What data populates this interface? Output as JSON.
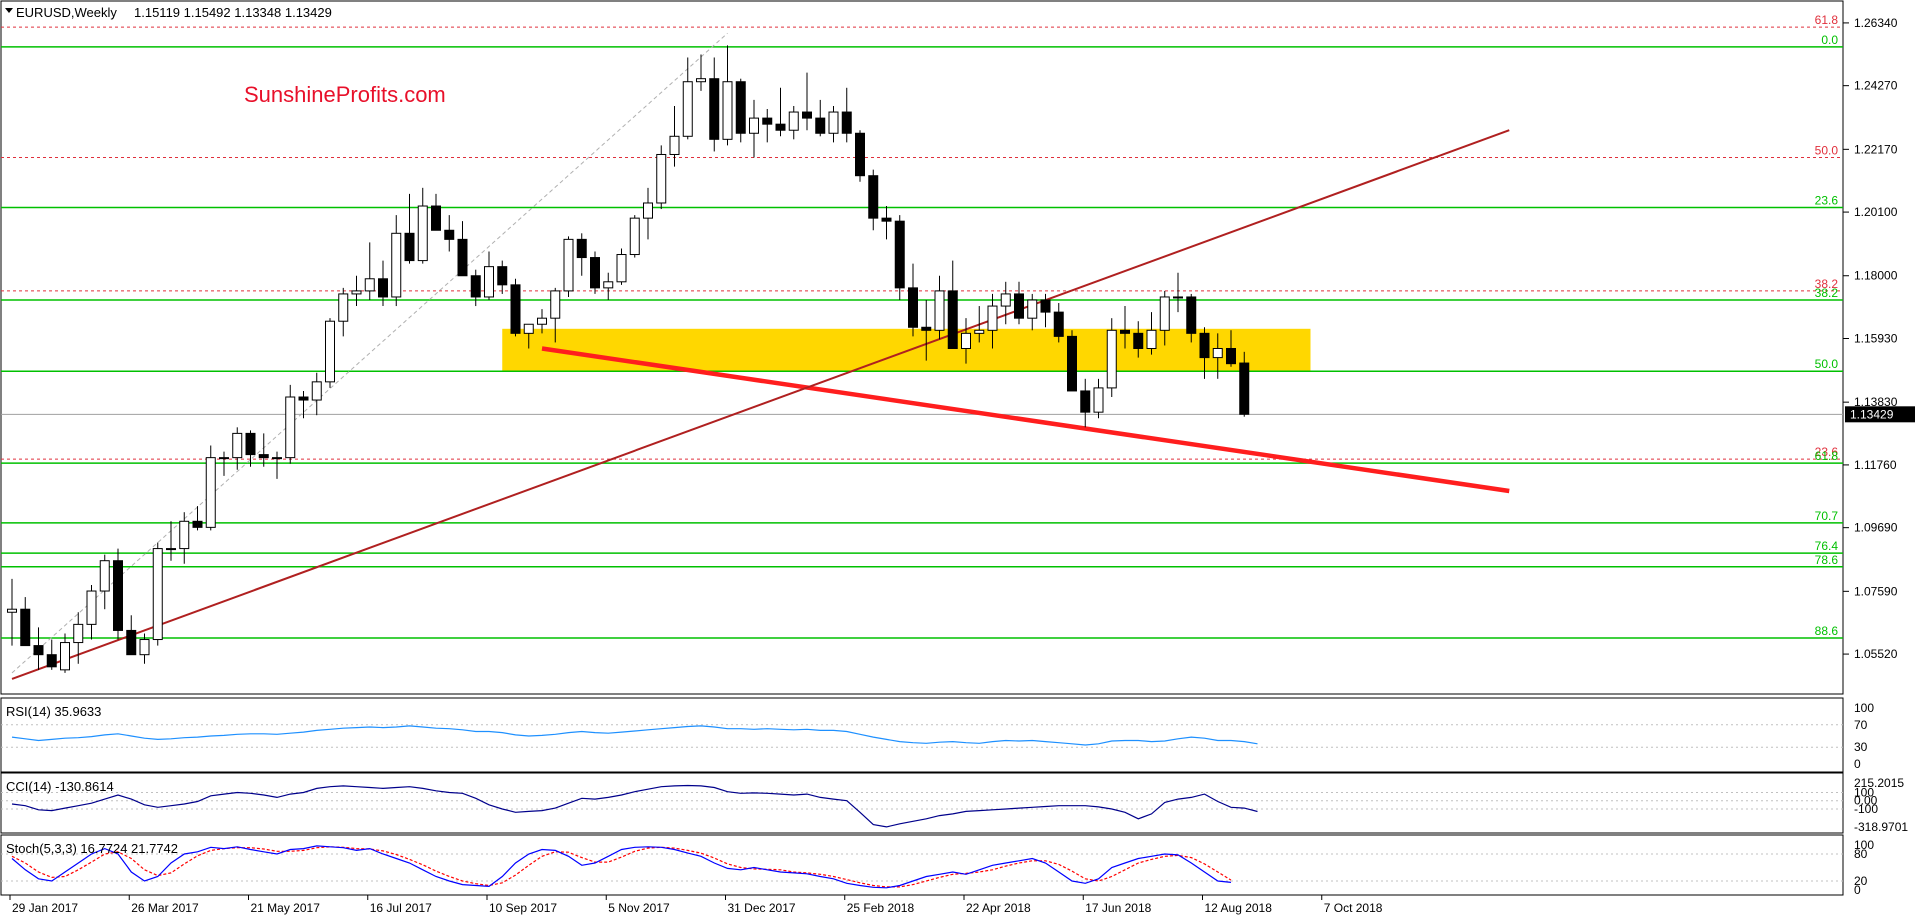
{
  "header": {
    "symbol": "EURUSD,Weekly",
    "ohlc": "1.15119 1.15492 1.13348 1.13429"
  },
  "watermark": "SunshineProfits.com",
  "current_price_label": "1.13429",
  "colors": {
    "bull_body": "#ffffff",
    "bear_body": "#000000",
    "candle_outline": "#000000",
    "support_zone": "#ffd700",
    "fib_level": "#00c000",
    "fib_dashed": "#e0303c",
    "red_trendline": "#ff1e1e",
    "brown_trendline": "#b02020",
    "rsi_line": "#1e90ff",
    "cci_line": "#00008b",
    "stoch_main": "#0000ff",
    "stoch_signal": "#ff0000",
    "watermark": "#e8102a"
  },
  "chart_data": {
    "type": "candlestick",
    "timeframe": "Weekly",
    "title": "EURUSD,Weekly 1.15119 1.15492 1.13348 1.13429",
    "ylim": [
      1.045,
      1.267
    ],
    "price_tick_labels": [
      "1.26340",
      "1.24270",
      "1.22170",
      "1.20100",
      "1.18000",
      "1.15930",
      "1.13830",
      "1.11760",
      "1.09690",
      "1.07590",
      "1.05520"
    ],
    "date_tick_labels": [
      "29 Jan 2017",
      "26 Mar 2017",
      "21 May 2017",
      "16 Jul 2017",
      "10 Sep 2017",
      "5 Nov 2017",
      "31 Dec 2017",
      "25 Feb 2018",
      "22 Apr 2018",
      "17 Jun 2018",
      "12 Aug 2018",
      "7 Oct 2018"
    ],
    "candles": [
      [
        1.069,
        1.08,
        1.058,
        1.07
      ],
      [
        1.07,
        1.074,
        1.058,
        1.058
      ],
      [
        1.058,
        1.064,
        1.05,
        1.055
      ],
      [
        1.055,
        1.06,
        1.05,
        1.051
      ],
      [
        1.05,
        1.062,
        1.049,
        1.059
      ],
      [
        1.059,
        1.069,
        1.052,
        1.065
      ],
      [
        1.065,
        1.078,
        1.06,
        1.076
      ],
      [
        1.076,
        1.088,
        1.07,
        1.086
      ],
      [
        1.086,
        1.09,
        1.06,
        1.063
      ],
      [
        1.063,
        1.068,
        1.057,
        1.055
      ],
      [
        1.055,
        1.062,
        1.052,
        1.06
      ],
      [
        1.06,
        1.092,
        1.058,
        1.09
      ],
      [
        1.09,
        1.099,
        1.086,
        1.09
      ],
      [
        1.09,
        1.102,
        1.085,
        1.099
      ],
      [
        1.099,
        1.104,
        1.096,
        1.097
      ],
      [
        1.097,
        1.124,
        1.096,
        1.12
      ],
      [
        1.12,
        1.122,
        1.114,
        1.12
      ],
      [
        1.12,
        1.13,
        1.116,
        1.128
      ],
      [
        1.128,
        1.129,
        1.117,
        1.121
      ],
      [
        1.121,
        1.128,
        1.117,
        1.12
      ],
      [
        1.12,
        1.122,
        1.113,
        1.12
      ],
      [
        1.12,
        1.144,
        1.118,
        1.14
      ],
      [
        1.14,
        1.142,
        1.133,
        1.139
      ],
      [
        1.139,
        1.148,
        1.134,
        1.145
      ],
      [
        1.145,
        1.166,
        1.143,
        1.165
      ],
      [
        1.165,
        1.176,
        1.16,
        1.174
      ],
      [
        1.174,
        1.18,
        1.17,
        1.175
      ],
      [
        1.175,
        1.191,
        1.172,
        1.179
      ],
      [
        1.179,
        1.185,
        1.17,
        1.173
      ],
      [
        1.173,
        1.2,
        1.17,
        1.194
      ],
      [
        1.194,
        1.207,
        1.184,
        1.185
      ],
      [
        1.185,
        1.209,
        1.184,
        1.203
      ],
      [
        1.203,
        1.207,
        1.195,
        1.195
      ],
      [
        1.195,
        1.2,
        1.188,
        1.192
      ],
      [
        1.192,
        1.198,
        1.182,
        1.18
      ],
      [
        1.18,
        1.182,
        1.17,
        1.173
      ],
      [
        1.173,
        1.188,
        1.172,
        1.183
      ],
      [
        1.183,
        1.185,
        1.174,
        1.177
      ],
      [
        1.177,
        1.179,
        1.16,
        1.161
      ],
      [
        1.161,
        1.164,
        1.156,
        1.164
      ],
      [
        1.164,
        1.169,
        1.161,
        1.166
      ],
      [
        1.166,
        1.176,
        1.158,
        1.175
      ],
      [
        1.175,
        1.193,
        1.173,
        1.192
      ],
      [
        1.192,
        1.194,
        1.18,
        1.186
      ],
      [
        1.186,
        1.188,
        1.174,
        1.176
      ],
      [
        1.176,
        1.181,
        1.172,
        1.178
      ],
      [
        1.178,
        1.189,
        1.177,
        1.187
      ],
      [
        1.187,
        1.2,
        1.186,
        1.199
      ],
      [
        1.199,
        1.209,
        1.192,
        1.204
      ],
      [
        1.204,
        1.223,
        1.202,
        1.22
      ],
      [
        1.22,
        1.236,
        1.216,
        1.226
      ],
      [
        1.226,
        1.252,
        1.225,
        1.244
      ],
      [
        1.244,
        1.253,
        1.241,
        1.245
      ],
      [
        1.245,
        1.252,
        1.221,
        1.225
      ],
      [
        1.225,
        1.256,
        1.223,
        1.244
      ],
      [
        1.244,
        1.245,
        1.224,
        1.227
      ],
      [
        1.227,
        1.238,
        1.219,
        1.232
      ],
      [
        1.232,
        1.235,
        1.224,
        1.23
      ],
      [
        1.23,
        1.242,
        1.226,
        1.228
      ],
      [
        1.228,
        1.236,
        1.225,
        1.234
      ],
      [
        1.234,
        1.247,
        1.228,
        1.232
      ],
      [
        1.232,
        1.238,
        1.226,
        1.227
      ],
      [
        1.227,
        1.236,
        1.224,
        1.234
      ],
      [
        1.234,
        1.242,
        1.224,
        1.227
      ],
      [
        1.227,
        1.228,
        1.211,
        1.213
      ],
      [
        1.213,
        1.215,
        1.195,
        1.199
      ],
      [
        1.199,
        1.203,
        1.192,
        1.198
      ],
      [
        1.198,
        1.2,
        1.172,
        1.176
      ],
      [
        1.176,
        1.184,
        1.16,
        1.163
      ],
      [
        1.163,
        1.172,
        1.152,
        1.162
      ],
      [
        1.162,
        1.18,
        1.159,
        1.175
      ],
      [
        1.175,
        1.185,
        1.156,
        1.156
      ],
      [
        1.156,
        1.166,
        1.151,
        1.161
      ],
      [
        1.161,
        1.17,
        1.158,
        1.162
      ],
      [
        1.162,
        1.174,
        1.156,
        1.17
      ],
      [
        1.17,
        1.178,
        1.164,
        1.174
      ],
      [
        1.174,
        1.178,
        1.164,
        1.166
      ],
      [
        1.166,
        1.174,
        1.162,
        1.172
      ],
      [
        1.172,
        1.174,
        1.163,
        1.168
      ],
      [
        1.168,
        1.171,
        1.158,
        1.16
      ],
      [
        1.16,
        1.162,
        1.147,
        1.142
      ],
      [
        1.142,
        1.146,
        1.13,
        1.135
      ],
      [
        1.135,
        1.146,
        1.133,
        1.143
      ],
      [
        1.143,
        1.166,
        1.14,
        1.162
      ],
      [
        1.162,
        1.17,
        1.156,
        1.161
      ],
      [
        1.161,
        1.165,
        1.153,
        1.156
      ],
      [
        1.156,
        1.168,
        1.154,
        1.162
      ],
      [
        1.162,
        1.175,
        1.157,
        1.173
      ],
      [
        1.173,
        1.181,
        1.168,
        1.173
      ],
      [
        1.173,
        1.174,
        1.158,
        1.161
      ],
      [
        1.161,
        1.163,
        1.146,
        1.153
      ],
      [
        1.153,
        1.161,
        1.146,
        1.156
      ],
      [
        1.156,
        1.162,
        1.15,
        1.151
      ],
      [
        1.1512,
        1.1549,
        1.1335,
        1.1343
      ]
    ],
    "fib_levels": [
      {
        "label": "61.8",
        "value": 1.262,
        "style": "dashed"
      },
      {
        "label": "0.0",
        "value": 1.2555,
        "style": "solid"
      },
      {
        "label": "50.0",
        "value": 1.219,
        "style": "dashed"
      },
      {
        "label": "23.6",
        "value": 1.2025,
        "style": "solid"
      },
      {
        "label": "38.2",
        "value": 1.175,
        "style": "dashed"
      },
      {
        "label": "38.2",
        "value": 1.172,
        "style": "solid"
      },
      {
        "label": "50.0",
        "value": 1.1485,
        "style": "solid"
      },
      {
        "label": "23.6",
        "value": 1.1195,
        "style": "dashed"
      },
      {
        "label": "61.8",
        "value": 1.1182,
        "style": "solid"
      },
      {
        "label": "70.7",
        "value": 1.0985,
        "style": "solid"
      },
      {
        "label": "76.4",
        "value": 1.0885,
        "style": "solid"
      },
      {
        "label": "78.6",
        "value": 1.084,
        "style": "solid"
      },
      {
        "label": "88.6",
        "value": 1.0605,
        "style": "solid"
      }
    ],
    "current_price_line": 1.13429,
    "support_zone": {
      "from_candle": 37,
      "to_candle": 98,
      "low": 1.1485,
      "high": 1.1625
    },
    "trendlines": [
      {
        "name": "red declining support",
        "from": [
          40,
          1.156
        ],
        "to": [
          113,
          1.109
        ]
      },
      {
        "name": "brown rising support",
        "from": [
          0,
          1.047
        ],
        "to": [
          113,
          1.228
        ]
      },
      {
        "name": "grey dashed",
        "from": [
          0,
          1.049
        ],
        "to": [
          54,
          1.26
        ]
      }
    ],
    "indicators": {
      "rsi": {
        "label": "RSI(14) 35.9633",
        "ticks": [
          "100",
          "70",
          "30",
          "0"
        ],
        "range": [
          0,
          100
        ],
        "values": [
          48,
          45,
          42,
          44,
          46,
          47,
          49,
          52,
          54,
          50,
          46,
          44,
          45,
          47,
          48,
          50,
          51,
          53,
          54,
          54,
          53,
          55,
          57,
          60,
          62,
          64,
          65,
          66,
          65,
          66,
          68,
          66,
          64,
          63,
          61,
          58,
          58,
          56,
          52,
          50,
          51,
          53,
          56,
          58,
          56,
          55,
          57,
          59,
          61,
          63,
          65,
          67,
          68,
          66,
          63,
          63,
          62,
          63,
          62,
          61,
          62,
          60,
          60,
          58,
          53,
          48,
          44,
          40,
          38,
          37,
          39,
          40,
          38,
          37,
          40,
          42,
          41,
          42,
          40,
          38,
          36,
          34,
          36,
          41,
          42,
          42,
          40,
          41,
          45,
          48,
          46,
          42,
          42,
          40,
          36
        ]
      },
      "cci": {
        "label": "CCI(14) -130.8614",
        "ticks": [
          "215.2015",
          "100",
          "0.00",
          "-100",
          "-318.9701"
        ],
        "range": [
          -318.9701,
          215.2015
        ],
        "values": [
          -40,
          -60,
          -110,
          -120,
          -90,
          -60,
          -30,
          20,
          70,
          20,
          -50,
          -80,
          -60,
          -40,
          -10,
          60,
          80,
          100,
          90,
          70,
          40,
          80,
          100,
          150,
          170,
          180,
          170,
          160,
          150,
          160,
          170,
          150,
          120,
          100,
          90,
          30,
          -50,
          -100,
          -140,
          -130,
          -120,
          -90,
          -30,
          30,
          20,
          40,
          70,
          110,
          140,
          170,
          180,
          185,
          180,
          160,
          110,
          90,
          95,
          90,
          80,
          70,
          80,
          40,
          20,
          0,
          -140,
          -290,
          -318,
          -280,
          -250,
          -220,
          -180,
          -160,
          -130,
          -120,
          -110,
          -100,
          -90,
          -80,
          -70,
          -60,
          -60,
          -60,
          -75,
          -100,
          -140,
          -220,
          -160,
          -20,
          20,
          40,
          80,
          -10,
          -80,
          -90,
          -131
        ]
      },
      "stoch": {
        "label": "Stoch(5,3,3) 16.7724 21.7742",
        "ticks": [
          "100",
          "80",
          "20",
          "0"
        ],
        "range": [
          0,
          100
        ],
        "main": [
          70,
          45,
          25,
          20,
          40,
          60,
          80,
          92,
          80,
          40,
          20,
          30,
          60,
          80,
          85,
          95,
          92,
          96,
          90,
          85,
          80,
          90,
          92,
          98,
          96,
          94,
          88,
          92,
          80,
          70,
          60,
          45,
          30,
          20,
          12,
          10,
          8,
          30,
          60,
          80,
          90,
          88,
          75,
          55,
          60,
          75,
          90,
          95,
          96,
          95,
          90,
          82,
          75,
          60,
          48,
          45,
          50,
          45,
          40,
          38,
          36,
          30,
          25,
          15,
          10,
          6,
          5,
          10,
          20,
          30,
          35,
          40,
          35,
          45,
          55,
          60,
          65,
          70,
          60,
          40,
          20,
          15,
          25,
          50,
          60,
          70,
          75,
          80,
          78,
          60,
          40,
          20,
          17
        ],
        "signal": [
          75,
          60,
          40,
          28,
          30,
          45,
          62,
          80,
          85,
          70,
          45,
          32,
          38,
          58,
          76,
          88,
          92,
          94,
          94,
          91,
          86,
          86,
          88,
          94,
          96,
          95,
          92,
          91,
          87,
          79,
          68,
          56,
          42,
          30,
          20,
          14,
          10,
          16,
          33,
          55,
          75,
          85,
          84,
          72,
          62,
          62,
          73,
          86,
          93,
          95,
          93,
          88,
          82,
          71,
          58,
          50,
          47,
          46,
          45,
          40,
          38,
          35,
          30,
          23,
          16,
          10,
          7,
          7,
          12,
          20,
          28,
          35,
          37,
          40,
          45,
          53,
          60,
          65,
          65,
          57,
          42,
          25,
          20,
          30,
          45,
          60,
          68,
          75,
          77,
          72,
          58,
          40,
          22
        ]
      }
    }
  }
}
